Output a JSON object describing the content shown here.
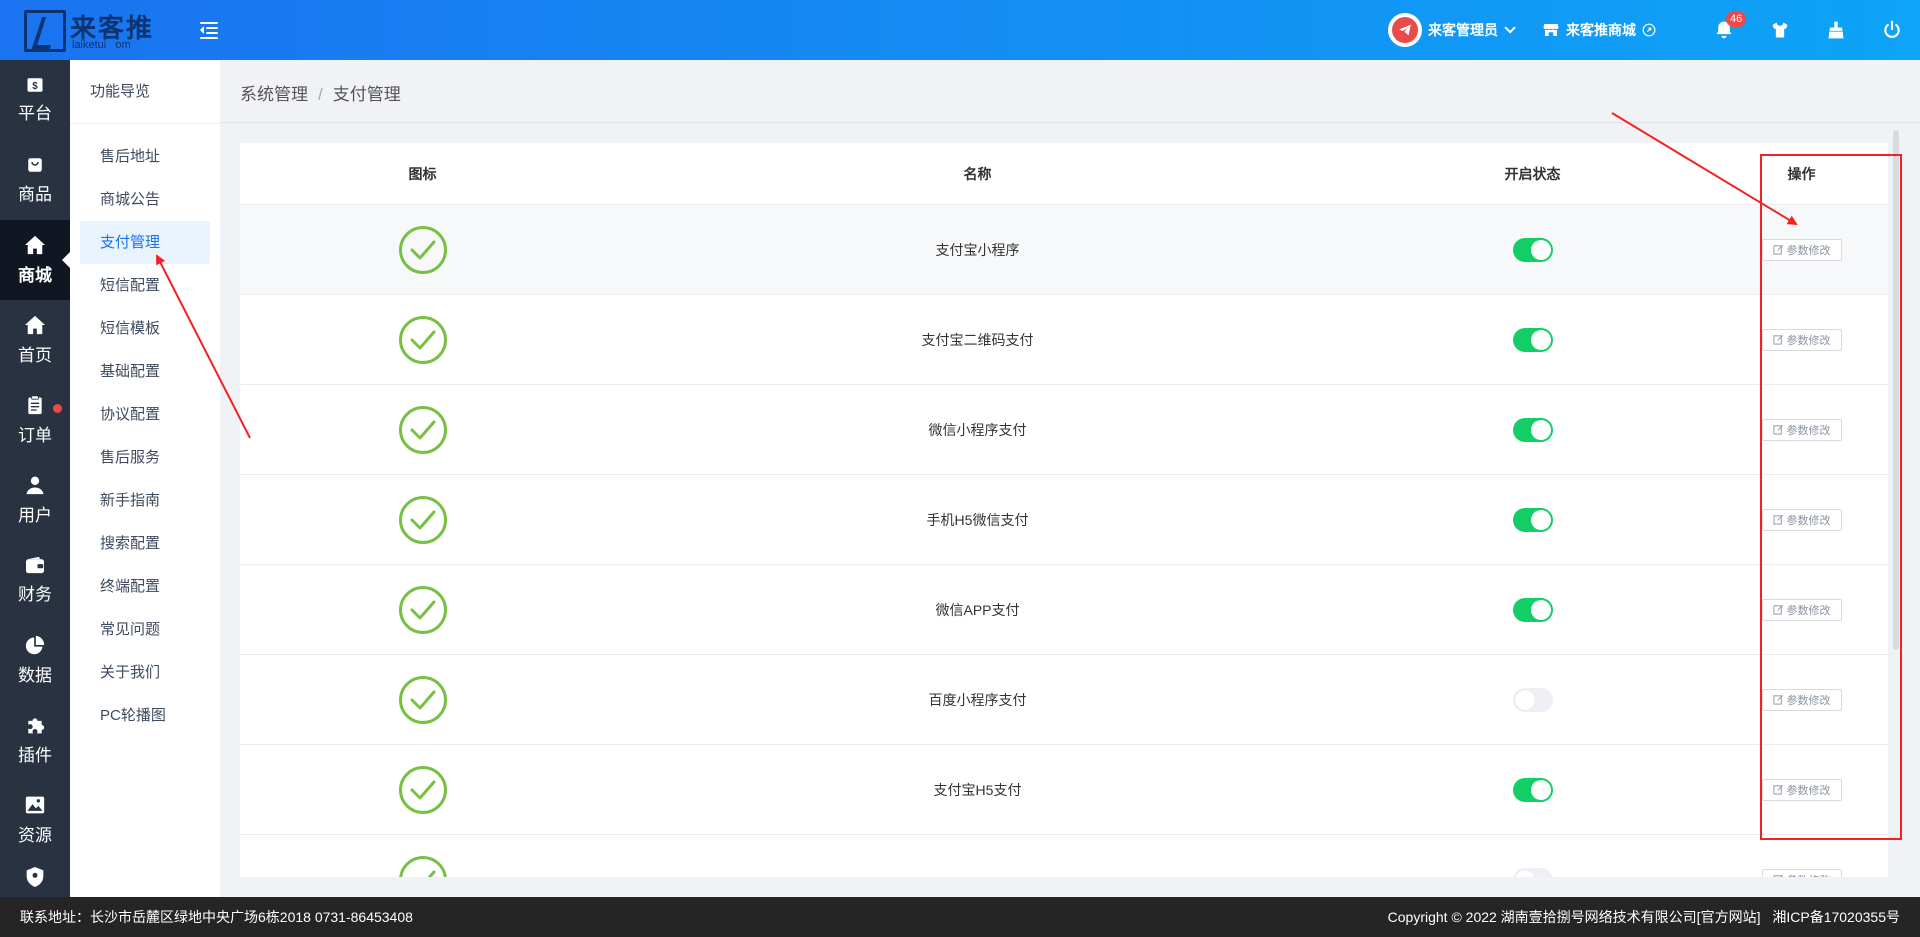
{
  "header": {
    "logo_cn": "来客推",
    "logo_en": "laiketui",
    "logo_en2": "om",
    "user_name": "来客管理员",
    "shop_name": "来客推商城",
    "notification_count": "46"
  },
  "leftnav": [
    {
      "label": "平台",
      "icon": "dollar-icon",
      "active": false
    },
    {
      "label": "商品",
      "icon": "bag-icon",
      "active": false
    },
    {
      "label": "商城",
      "icon": "home-icon",
      "active": true
    },
    {
      "label": "首页",
      "icon": "house-icon",
      "active": false
    },
    {
      "label": "订单",
      "icon": "clipboard-icon",
      "active": false
    },
    {
      "label": "用户",
      "icon": "user-icon",
      "active": false
    },
    {
      "label": "财务",
      "icon": "wallet-icon",
      "active": false
    },
    {
      "label": "数据",
      "icon": "pie-chart-icon",
      "active": false
    },
    {
      "label": "插件",
      "icon": "puzzle-icon",
      "active": false
    },
    {
      "label": "资源",
      "icon": "image-icon",
      "active": false
    }
  ],
  "submenu": {
    "first": "功能导览",
    "items": [
      "售后地址",
      "商城公告",
      "支付管理",
      "短信配置",
      "短信模板",
      "基础配置",
      "协议配置",
      "售后服务",
      "新手指南",
      "搜索配置",
      "终端配置",
      "常见问题",
      "关于我们",
      "PC轮播图"
    ],
    "active_index": 2
  },
  "breadcrumb": {
    "root": "系统管理",
    "sep": "/",
    "current": "支付管理"
  },
  "table": {
    "headers": {
      "icon": "图标",
      "name": "名称",
      "state": "开启状态",
      "op": "操作"
    },
    "edit_label": "参数修改",
    "rows": [
      {
        "name": "支付宝小程序",
        "enabled": true
      },
      {
        "name": "支付宝二维码支付",
        "enabled": true
      },
      {
        "name": "微信小程序支付",
        "enabled": true
      },
      {
        "name": "手机H5微信支付",
        "enabled": true
      },
      {
        "name": "微信APP支付",
        "enabled": true
      },
      {
        "name": "百度小程序支付",
        "enabled": false
      },
      {
        "name": "支付宝H5支付",
        "enabled": true
      },
      {
        "name": "",
        "enabled": false
      }
    ]
  },
  "footer": {
    "address": "联系地址：长沙市岳麓区绿地中央广场6栋2018 0731-86453408",
    "copyright": "Copyright © 2022 湖南壹拾捌号网络技术有限公司[官方网站]",
    "icp": "湘ICP备17020355号"
  },
  "colors": {
    "header_start": "#1a73f0",
    "header_end": "#0ea4f7",
    "nav_bg": "#293240",
    "switch_on": "#13ce66",
    "check_green": "#78c043",
    "annotation_red": "#f32222"
  }
}
